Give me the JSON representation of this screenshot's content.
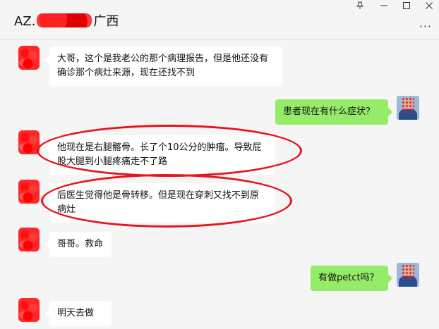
{
  "window": {
    "title_prefix": "AZ.",
    "title_suffix": "广西",
    "pin_icon": "pin-icon",
    "minimize_icon": "minimize-icon",
    "maximize_icon": "maximize-icon",
    "close_icon": "close-icon",
    "more_icon": "more-icon"
  },
  "messages": [
    {
      "side": "left",
      "text": "大哥，这个是我老公的那个病理报告，但是他还没有确诊那个病灶来源，现在还找不到"
    },
    {
      "side": "right",
      "text": "患者现在有什么症状？"
    },
    {
      "side": "left",
      "text": "他现在是右腿髂骨。长了个10公分的肿瘤。导致屁股大腿到小腿疼痛走不了路"
    },
    {
      "side": "left",
      "text": "后医生觉得他是骨转移。但是现在穿刺又找不到原病灶"
    },
    {
      "side": "left",
      "text": "哥哥。救命"
    },
    {
      "side": "right",
      "text": "有做petct吗？"
    },
    {
      "side": "left",
      "text": "明天去做"
    }
  ],
  "colors": {
    "incoming_bubble": "#ffffff",
    "outgoing_bubble": "#95ec69",
    "annotation_ellipse": "#e8141c"
  }
}
